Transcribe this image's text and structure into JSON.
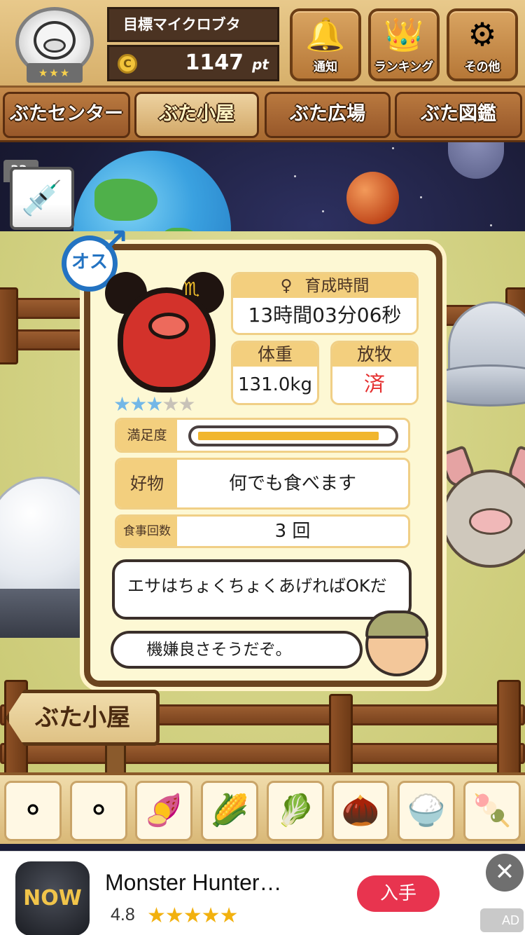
{
  "header": {
    "player_rank_stars": "★★★",
    "goal_text": "目標マイクロブタ",
    "coin_symbol": "C",
    "points_value": "1147",
    "points_unit": "pt",
    "buttons": [
      {
        "label": "通知",
        "icon": "bell-icon"
      },
      {
        "label": "ランキング",
        "icon": "crown-icon"
      },
      {
        "label": "その他",
        "icon": "gear-icon"
      }
    ]
  },
  "nav": {
    "tabs": [
      "ぶたセンター",
      "ぶた小屋",
      "ぶた広場",
      "ぶた図鑑"
    ],
    "active_index": 1
  },
  "item": {
    "count": "33",
    "icon": "syringe-icon"
  },
  "pig": {
    "sex_label": "オス",
    "zodiac_sign": "♏",
    "rarity": 3,
    "rarity_max": 5,
    "stars_on": "★★★",
    "stars_off": "★★",
    "growth_time_label": "育成時間",
    "growth_time_value": "13時間03分06秒",
    "weight_label": "体重",
    "weight_value": "131.0kg",
    "graze_label": "放牧",
    "graze_value": "済",
    "satisfaction_label": "満足度",
    "satisfaction_level": 0.95,
    "favorite_label": "好物",
    "favorite_value": "何でも食べます",
    "meal_count_label": "食事回数",
    "meal_count_value": "3 回"
  },
  "dialogue": {
    "line1": "エサはちょくちょくあげればOKだ",
    "line2": "機嫌良さそうだぞ。"
  },
  "location_sign": "ぶた小屋",
  "food_items": [
    {
      "icon": "soybeans-icon",
      "glyph": "⚬"
    },
    {
      "icon": "beans-mix-icon",
      "glyph": "⚬"
    },
    {
      "icon": "sweet-potato-icon",
      "glyph": "🍠"
    },
    {
      "icon": "corn-icon",
      "glyph": "🌽"
    },
    {
      "icon": "vegetable-leaf-icon",
      "glyph": "🥬"
    },
    {
      "icon": "acorn-icon",
      "glyph": "🌰"
    },
    {
      "icon": "grain-plate-icon",
      "glyph": "🍚"
    },
    {
      "icon": "meatball-plate-icon",
      "glyph": "🍡"
    }
  ],
  "ad": {
    "app_icon_text": "NOW",
    "title": "Monster Hunter…",
    "rating": "4.8",
    "stars": "★★★★★",
    "get_button": "入手",
    "close": "✕",
    "ad_mark": "AD"
  },
  "colors": {
    "accent_blue": "#2373c2",
    "satisfaction": "#f1b62e",
    "graze_done": "#e53030",
    "ad_button": "#e8344f"
  }
}
